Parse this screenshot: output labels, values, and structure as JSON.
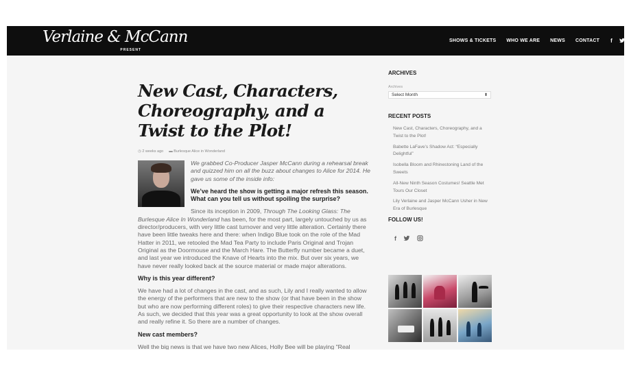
{
  "header": {
    "logo_text": "Verlaine & McCann",
    "logo_sub": "PRESENT",
    "nav": [
      "SHOWS & TICKETS",
      "WHO WE ARE",
      "NEWS",
      "CONTACT"
    ],
    "social_icons": [
      "facebook-icon",
      "twitter-icon",
      "instagram-icon"
    ],
    "social_glyphs": [
      "f",
      "t",
      "◎"
    ]
  },
  "article": {
    "title": "New Cast, Characters, Choreography, and a Twist to the Plot!",
    "time_ago": "2 weeks ago",
    "category": "Burlesque Alice in Wonderland",
    "intro": "We grabbed Co-Producer Jasper McCann during a rehearsal break and quizzed him on all the buzz about changes to Alice for 2014. He gave us some of the inside info:",
    "q1": "We’ve heard the show is getting a major refresh this season. What can you tell us without spoiling the surprise?",
    "a1_lead": "Since its inception in 2009, ",
    "a1_italic": "Through The Looking Glass: The Burlesque Alice In Wonderland",
    "a1_rest": " has been, for the most part, largely untouched by us as director/producers, with very little cast turnover and very little alteration. Certainly there have been little tweaks here and there: when Indigo Blue took on the role of the Mad Hatter in 2011, we retooled the Mad Tea Party to include Paris Original and Trojan Original as the Doormouse and the March Hare. The Butterfly number became a duet, and last year we introduced the Knave of Hearts into the mix. But over six years, we have never really looked back at the source material or made major alterations.",
    "q2": "Why is this year different?",
    "a2": "We have had a lot of changes in the cast, and as such, Lily and I really wanted to allow the energy of the performers that are new to the show (or that have been in the show but who are now performing different roles) to give their respective characters new life. As such, we decided that this year was a great opportunity to look at the show overall and really refine it. So there are a number of changes.",
    "q3": "New cast members?",
    "a3": "Well the big news is that we have two new Alices, Holly Bee will be playing \"Real"
  },
  "sidebar": {
    "archives_title": "ARCHIVES",
    "archives_label": "Archives",
    "archives_select": "Select Month",
    "recent_title": "RECENT POSTS",
    "recent_posts": [
      "New Cast, Characters, Choreography, and a Twist to the Plot!",
      "Babette LaFave’s Shadow Act: “Especially Delightful”",
      "Isobella Bloom and Rhinestoning Land of the Sweets",
      "All-New Ninth Season Costumes! Seattle Met Tours Our Closet",
      "Lily Verlaine and Jasper McCann Usher in New Era of Burlesque"
    ],
    "follow_title": "FOLLOW US!"
  },
  "colors": {
    "header_bg": "#0e0e0e",
    "page_bg": "#f5f5f5",
    "text": "#666666"
  }
}
